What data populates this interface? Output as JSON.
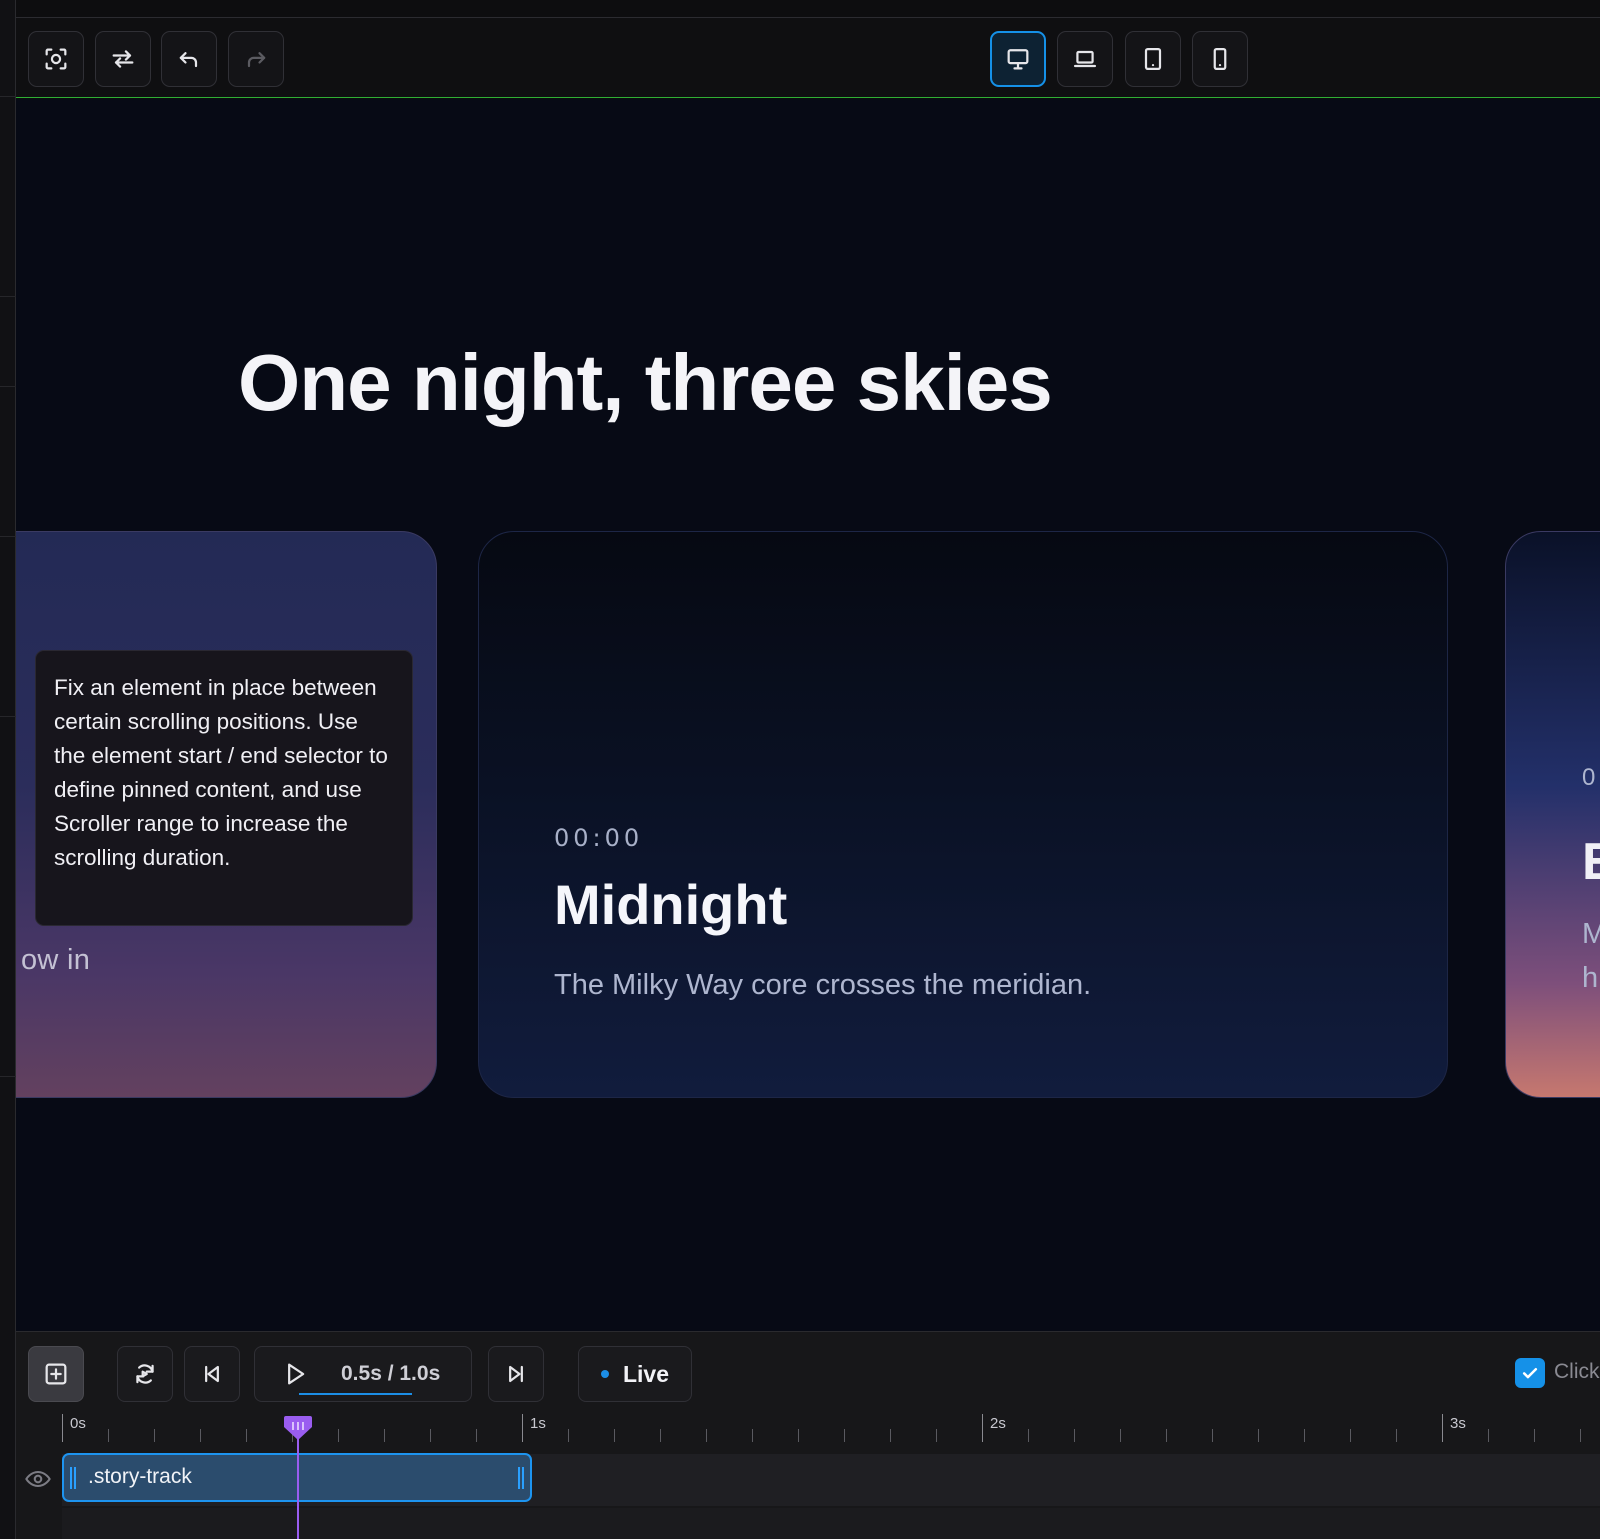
{
  "toolbar": {
    "left_buttons": [
      {
        "name": "focus-frame",
        "icon": "focus-frame-icon"
      },
      {
        "name": "swap",
        "icon": "swap-arrows-icon"
      },
      {
        "name": "undo",
        "icon": "undo-icon"
      },
      {
        "name": "redo",
        "icon": "redo-icon",
        "disabled": true
      }
    ],
    "device_buttons": [
      {
        "name": "desktop",
        "icon": "desktop-icon",
        "active": true
      },
      {
        "name": "laptop",
        "icon": "laptop-icon"
      },
      {
        "name": "tablet",
        "icon": "tablet-icon"
      },
      {
        "name": "phone",
        "icon": "phone-icon"
      }
    ],
    "accent_color": "#1591e8"
  },
  "preview": {
    "headline": "One night, three skies",
    "left_card": {
      "text_fragment": "ow in"
    },
    "middle_card": {
      "time": "00:00",
      "title": "Midnight",
      "description": "The Milky Way core crosses the meridian."
    },
    "right_card": {
      "time_fragment": "0",
      "title_fragment": "E",
      "line1_fragment": "M",
      "line2_fragment": "h"
    }
  },
  "tooltip": {
    "text": "Fix an element in place between certain scrolling positions. Use the element start / end selector to define pinned content, and use Scroller range to increase the scrolling duration."
  },
  "timeline": {
    "playback_time": "0.5s / 1.0s",
    "playback_progress": 0.5,
    "live_label": "Live",
    "checkbox_label": "Click",
    "checkbox_checked": true,
    "ruler_labels": [
      "0s",
      "1s",
      "2s",
      "3s"
    ],
    "track_name": ".story-track",
    "playhead_color": "#9a5df0"
  }
}
